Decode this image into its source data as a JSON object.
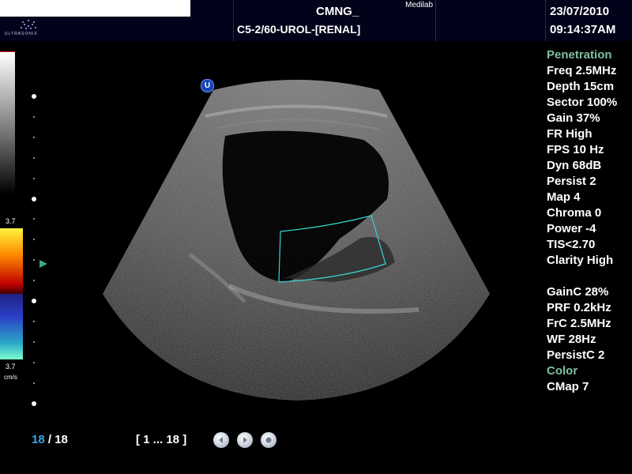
{
  "header": {
    "patient_name": "",
    "logo_text": "ULTRASONIX",
    "title": "CMNG_",
    "organization": "Medilab",
    "probe_preset": "C5-2/60-UROL-[RENAL]",
    "date": "23/07/2010",
    "time": "09:14:37AM"
  },
  "scale": {
    "color_max": "3.7",
    "color_min": "3.7",
    "velocity_unit": "cm/s"
  },
  "image": {
    "orientation_marker": "U"
  },
  "parameters": {
    "bmode_section": "Penetration",
    "bmode": [
      "Freq 2.5MHz",
      "Depth 15cm",
      "Sector 100%",
      "Gain 37%",
      "FR High",
      "FPS 10 Hz",
      "Dyn 68dB",
      "Persist 2",
      "Map 4",
      "Chroma 0",
      "Power -4",
      "TIS<2.70",
      "Clarity High"
    ],
    "color": [
      "GainC 28%",
      "PRF 0.2kHz",
      "FrC 2.5MHz",
      "WF 28Hz",
      "PersistC 2"
    ],
    "color_section": "Color",
    "color_map": "CMap 7"
  },
  "footer": {
    "frame_current": "18",
    "frame_total": "/ 18",
    "frame_range": "[ 1 ... 18 ]"
  },
  "colors": {
    "header_bg": "#02021a",
    "accent_blue": "#39a6e8",
    "section_green": "#7fbfa0",
    "color_box": "#36d6d0"
  },
  "icons": [
    "logo-icon",
    "step-back-icon",
    "play-icon",
    "stop-icon"
  ]
}
